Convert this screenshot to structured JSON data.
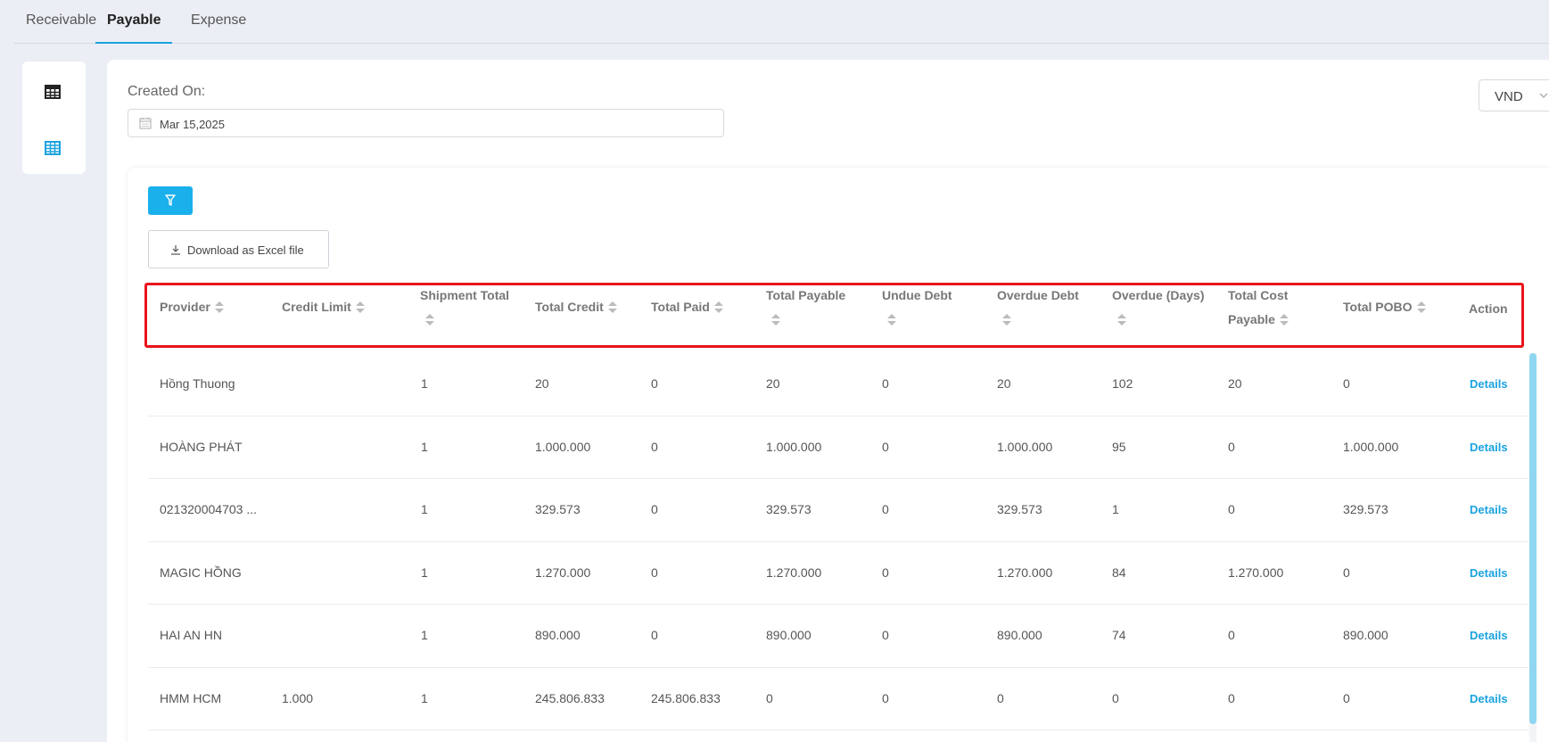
{
  "tabs": [
    {
      "label": "Receivable",
      "active": false
    },
    {
      "label": "Payable",
      "active": true
    },
    {
      "label": "Expense",
      "active": false
    }
  ],
  "sidebar": {
    "items": [
      {
        "icon": "table-icon",
        "color": "#222222"
      },
      {
        "icon": "grid-table-icon",
        "color": "#1aa3e0"
      }
    ]
  },
  "filters": {
    "created_on_label": "Created On:",
    "created_on_value": "Mar 15,2025",
    "currency": "VND"
  },
  "toolbar": {
    "filter_icon": "filter-icon",
    "download_label": "Download as Excel file"
  },
  "table": {
    "columns": [
      {
        "line1": "Provider",
        "line2": ""
      },
      {
        "line1": "Credit Limit",
        "line2": ""
      },
      {
        "line1": "Shipment Total",
        "line2": ""
      },
      {
        "line1": "Total Credit",
        "line2": ""
      },
      {
        "line1": "Total Paid",
        "line2": ""
      },
      {
        "line1": "Total Payable",
        "line2": ""
      },
      {
        "line1": "Undue Debt",
        "line2": ""
      },
      {
        "line1": "Overdue Debt",
        "line2": ""
      },
      {
        "line1": "Overdue (Days)",
        "line2": ""
      },
      {
        "line1": "Total Cost",
        "line2": "Payable"
      },
      {
        "line1": "Total POBO",
        "line2": ""
      },
      {
        "line1": "Action",
        "line2": ""
      }
    ],
    "rows": [
      [
        "Hồng Thuong",
        "",
        "1",
        "20",
        "0",
        "20",
        "0",
        "20",
        "102",
        "20",
        "0",
        "Details"
      ],
      [
        "HOÀNG PHÁT",
        "",
        "1",
        "1.000.000",
        "0",
        "1.000.000",
        "0",
        "1.000.000",
        "95",
        "0",
        "1.000.000",
        "Details"
      ],
      [
        "021320004703 ...",
        "",
        "1",
        "329.573",
        "0",
        "329.573",
        "0",
        "329.573",
        "1",
        "0",
        "329.573",
        "Details"
      ],
      [
        "MAGIC HỒNG",
        "",
        "1",
        "1.270.000",
        "0",
        "1.270.000",
        "0",
        "1.270.000",
        "84",
        "1.270.000",
        "0",
        "Details"
      ],
      [
        "HAI AN HN",
        "",
        "1",
        "890.000",
        "0",
        "890.000",
        "0",
        "890.000",
        "74",
        "0",
        "890.000",
        "Details"
      ],
      [
        "HMM HCM",
        "1.000",
        "1",
        "245.806.833",
        "245.806.833",
        "0",
        "0",
        "0",
        "0",
        "0",
        "0",
        "Details"
      ]
    ]
  },
  "colors": {
    "accent": "#1aa3e0",
    "highlight_border": "#e8141b"
  }
}
